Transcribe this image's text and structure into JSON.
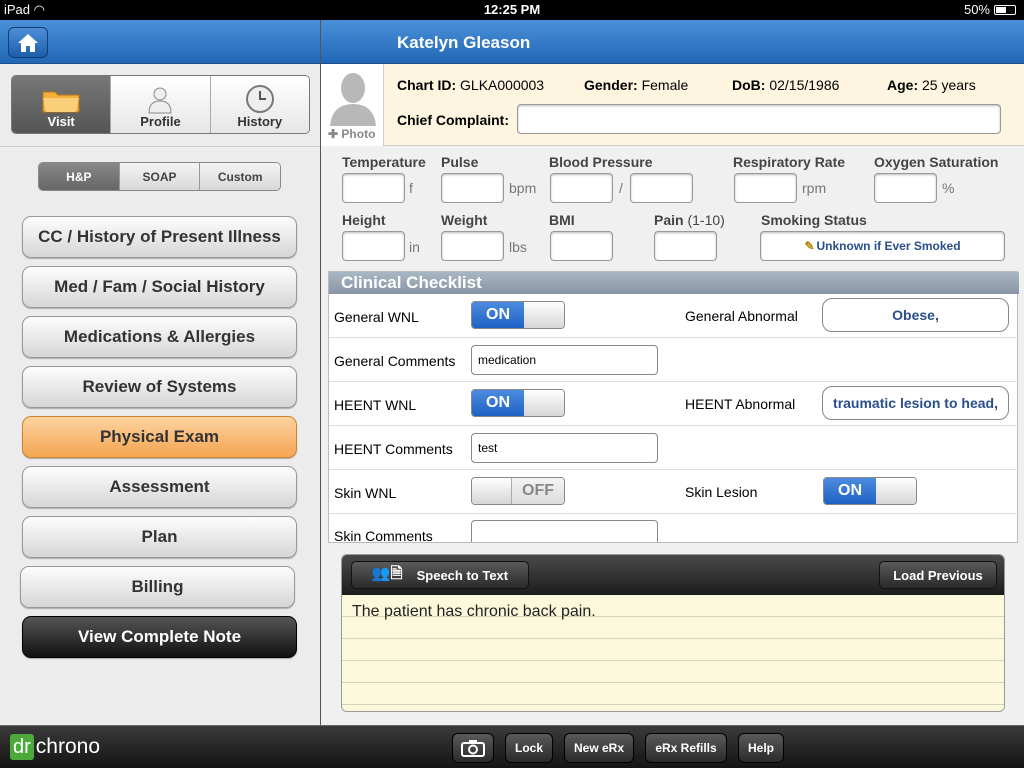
{
  "status": {
    "device": "iPad",
    "time": "12:25 PM",
    "battery": "50%"
  },
  "left": {
    "tabs": [
      {
        "label": "Visit"
      },
      {
        "label": "Profile"
      },
      {
        "label": "History"
      }
    ],
    "segments": [
      "H&P",
      "SOAP",
      "Custom"
    ],
    "nav": [
      "CC / History of Present Illness",
      "Med / Fam / Social History",
      "Medications & Allergies",
      "Review of Systems",
      "Physical Exam",
      "Assessment",
      "Plan",
      "Billing",
      "View Complete Note"
    ]
  },
  "header": {
    "patient_name": "Katelyn Gleason"
  },
  "patient": {
    "photo_label": "Photo",
    "chart_id_label": "Chart ID:",
    "chart_id": "GLKA000003",
    "gender_label": "Gender:",
    "gender": "Female",
    "dob_label": "DoB:",
    "dob": "02/15/1986",
    "age_label": "Age:",
    "age": "25 years",
    "complaint_label": "Chief Complaint:",
    "complaint_value": ""
  },
  "vitals": {
    "temperature": "Temperature",
    "temp_unit": "f",
    "pulse": "Pulse",
    "pulse_unit": "bpm",
    "bp": "Blood Pressure",
    "bp_sep": "/",
    "resp": "Respiratory Rate",
    "resp_unit": "rpm",
    "oxygen": "Oxygen Saturation",
    "oxygen_unit": "%",
    "height": "Height",
    "height_unit": "in",
    "weight": "Weight",
    "weight_unit": "lbs",
    "bmi": "BMI",
    "pain": "Pain",
    "pain_range": "(1-10)",
    "smoking": "Smoking Status",
    "smoking_value": "Unknown if Ever Smoked"
  },
  "checklist": {
    "title": "Clinical Checklist",
    "general_wnl": "General WNL",
    "on": "ON",
    "off": "OFF",
    "general_abnormal": "General Abnormal",
    "general_abnormal_value": "Obese,",
    "general_comments": "General Comments",
    "general_comments_value": "medication",
    "heent_wnl": "HEENT WNL",
    "heent_abnormal": "HEENT Abnormal",
    "heent_abnormal_value": "traumatic lesion to head,",
    "heent_comments": "HEENT Comments",
    "heent_comments_value": "test",
    "skin_wnl": "Skin WNL",
    "skin_lesion": "Skin Lesion",
    "skin_comments": "Skin Comments",
    "skin_comments_value": ""
  },
  "notes": {
    "speech": "Speech to Text",
    "load_previous": "Load Previous",
    "text": "The patient has chronic back pain."
  },
  "bottom": {
    "brand_dr": "dr",
    "brand_chrono": "chrono",
    "lock": "Lock",
    "new_erx": "New eRx",
    "erx_refills": "eRx Refills",
    "help": "Help"
  }
}
